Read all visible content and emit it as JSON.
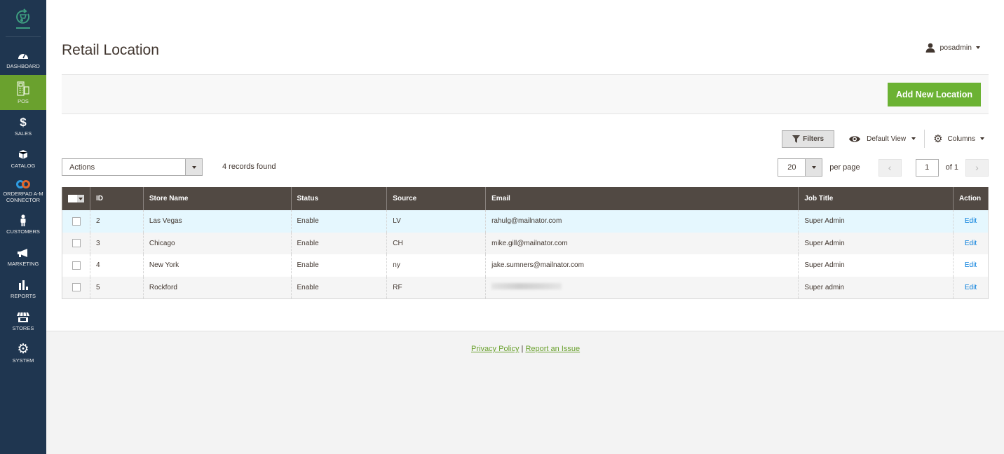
{
  "sidebar": {
    "logo": "pos-cart-logo-icon",
    "items": [
      {
        "label": "DASHBOARD",
        "icon": "speedometer-icon",
        "active": false
      },
      {
        "label": "POS",
        "icon": "pos-terminal-icon",
        "active": true
      },
      {
        "label": "SALES",
        "icon": "dollar-icon",
        "active": false
      },
      {
        "label": "CATALOG",
        "icon": "box-icon",
        "active": false
      },
      {
        "label": "ORDERPAD A-M CONNECTOR",
        "label_line1": "ORDERPAD A-M",
        "label_line2": "CONNECTOR",
        "icon": "chain-link-icon",
        "active": false
      },
      {
        "label": "CUSTOMERS",
        "icon": "person-icon",
        "active": false
      },
      {
        "label": "MARKETING",
        "icon": "megaphone-icon",
        "active": false
      },
      {
        "label": "REPORTS",
        "icon": "bar-chart-icon",
        "active": false
      },
      {
        "label": "STORES",
        "icon": "storefront-icon",
        "active": false
      },
      {
        "label": "SYSTEM",
        "icon": "gear-icon",
        "active": false
      }
    ]
  },
  "header": {
    "title": "Retail Location",
    "user": "posadmin"
  },
  "action_bar": {
    "add_button": "Add New Location"
  },
  "toolbar": {
    "filters": "Filters",
    "view": "Default View",
    "columns": "Columns",
    "actions": "Actions",
    "records_found": "4 records found",
    "per_page_value": "20",
    "per_page_label": "per page",
    "page_current": "1",
    "page_of": "of 1"
  },
  "table": {
    "columns": [
      "ID",
      "Store Name",
      "Status",
      "Source",
      "Email",
      "Job Title",
      "Action"
    ],
    "rows": [
      {
        "id": "2",
        "store_name": "Las Vegas",
        "status": "Enable",
        "source": "LV",
        "email": "rahulg@mailnator.com",
        "job_title": "Super Admin",
        "action": "Edit"
      },
      {
        "id": "3",
        "store_name": "Chicago",
        "status": "Enable",
        "source": "CH",
        "email": "mike.gill@mailnator.com",
        "job_title": "Super Admin",
        "action": "Edit"
      },
      {
        "id": "4",
        "store_name": "New York",
        "status": "Enable",
        "source": "ny",
        "email": "jake.sumners@mailnator.com",
        "job_title": "Super Admin",
        "action": "Edit"
      },
      {
        "id": "5",
        "store_name": "Rockford",
        "status": "Enable",
        "source": "RF",
        "email": "",
        "email_blurred": true,
        "job_title": "Super admin",
        "action": "Edit"
      }
    ]
  },
  "footer": {
    "privacy": "Privacy Policy",
    "separator": "|",
    "report": "Report an Issue"
  },
  "colors": {
    "sidebar_bg": "#1f3650",
    "active_nav": "#6aa12e",
    "primary_button": "#6bb233",
    "table_header": "#514943",
    "link": "#007bdb",
    "footer_link": "#6aa12e"
  }
}
